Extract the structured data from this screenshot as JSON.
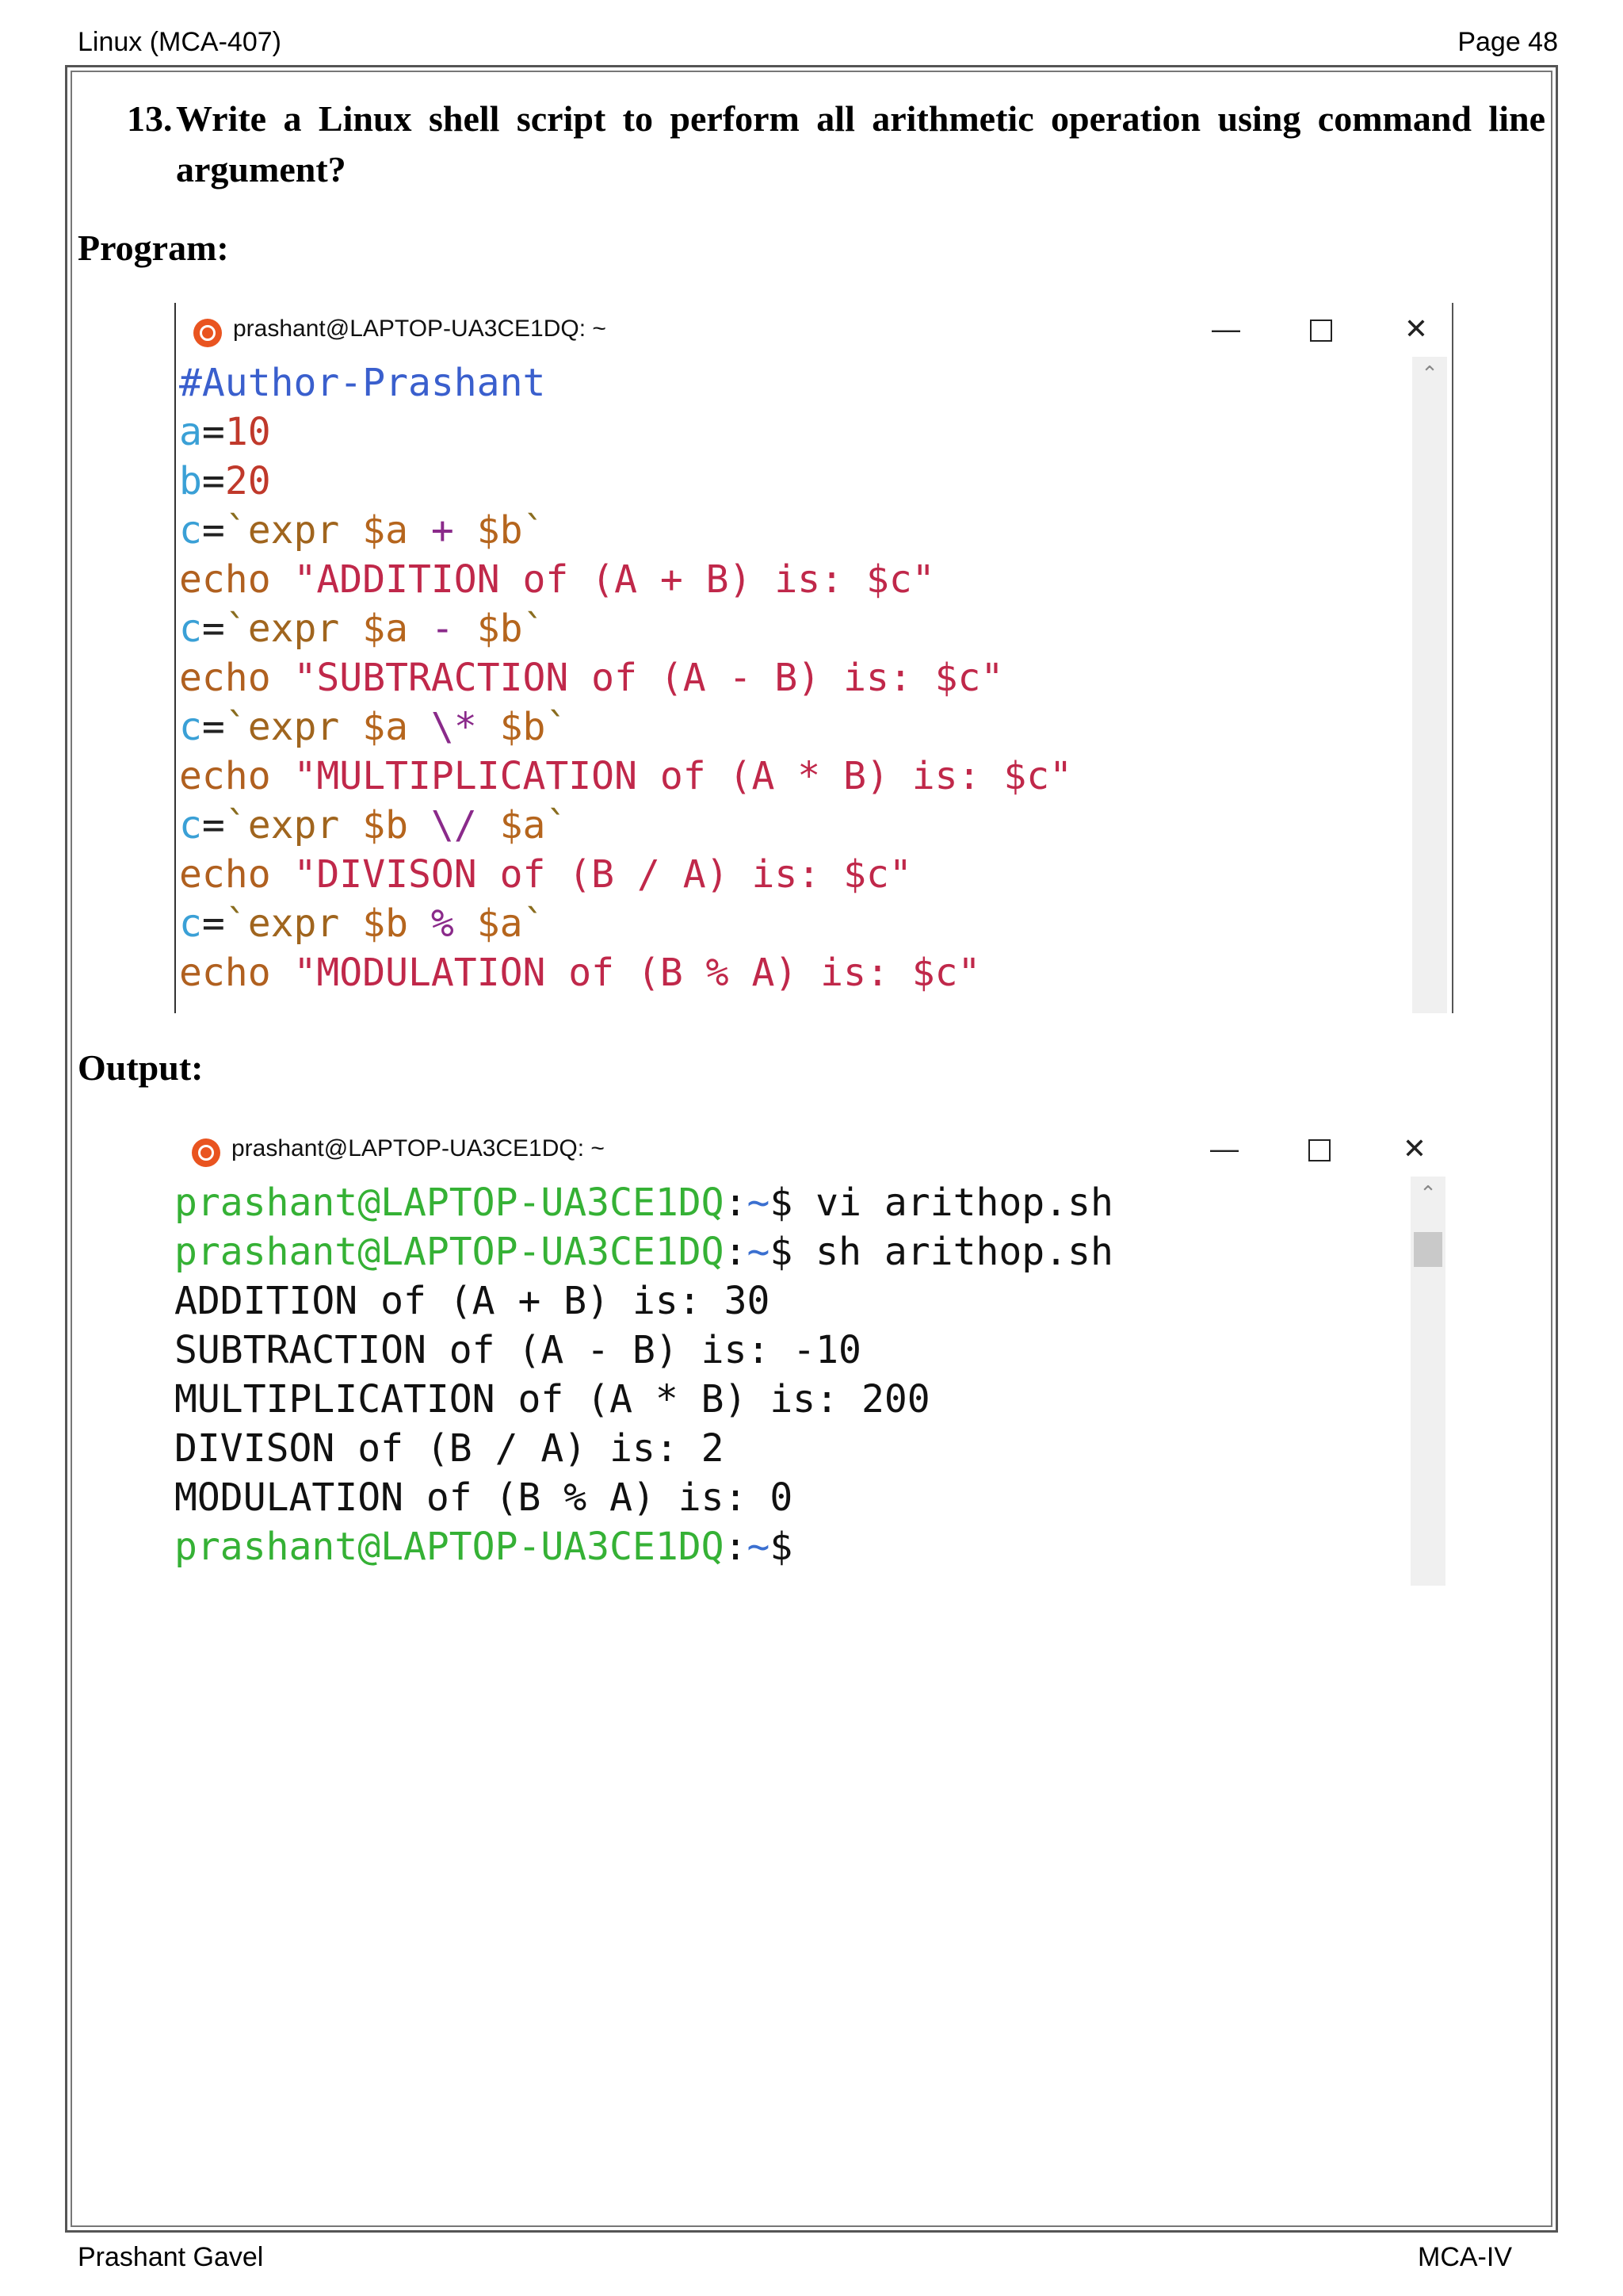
{
  "header": {
    "course": "Linux (MCA-407)",
    "page": "Page 48"
  },
  "footer": {
    "author": "Prashant Gavel",
    "class": "MCA-IV"
  },
  "question": {
    "number": "13.",
    "text": "Write a Linux shell script to perform all arithmetic operation using command line argument?"
  },
  "program_heading": "Program:",
  "output_heading": "Output:",
  "program_window": {
    "title": "prashant@LAPTOP-UA3CE1DQ: ~",
    "lines": [
      "#Author-Prashant",
      "a=10",
      "b=20",
      "c=`expr $a + $b`",
      "echo \"ADDITION of (A + B) is: $c\"",
      "c=`expr $a - $b`",
      "echo \"SUBTRACTION of (A - B) is: $c\"",
      "c=`expr $a \\* $b`",
      "echo \"MULTIPLICATION of (A * B) is: $c\"",
      "c=`expr $b \\/ $a`",
      "echo \"DIVISON of (B / A) is: $c\"",
      "c=`expr $b % $a`",
      "echo \"MODULATION of (B % A) is: $c\""
    ]
  },
  "output_window": {
    "title": "prashant@LAPTOP-UA3CE1DQ: ~",
    "prompt_user": "prashant@LAPTOP-UA3CE1DQ",
    "prompt_sep": ":",
    "prompt_path": "~",
    "prompt_sign": "$",
    "commands": [
      " vi arithop.sh",
      " sh arithop.sh"
    ],
    "results": [
      "ADDITION of (A + B) is: 30",
      "SUBTRACTION of (A - B) is: -10",
      "MULTIPLICATION of (A * B) is: 200",
      "DIVISON of (B / A) is: 2",
      "MODULATION of (B % A) is: 0"
    ]
  },
  "window_controls": {
    "minimize": "—",
    "close": "✕"
  },
  "colors": {
    "prompt_user": "#35b135",
    "prompt_path": "#3a6fd0",
    "comment": "#3a5fcd",
    "string": "#c0284a",
    "ubuntu_icon": "#e95420"
  }
}
